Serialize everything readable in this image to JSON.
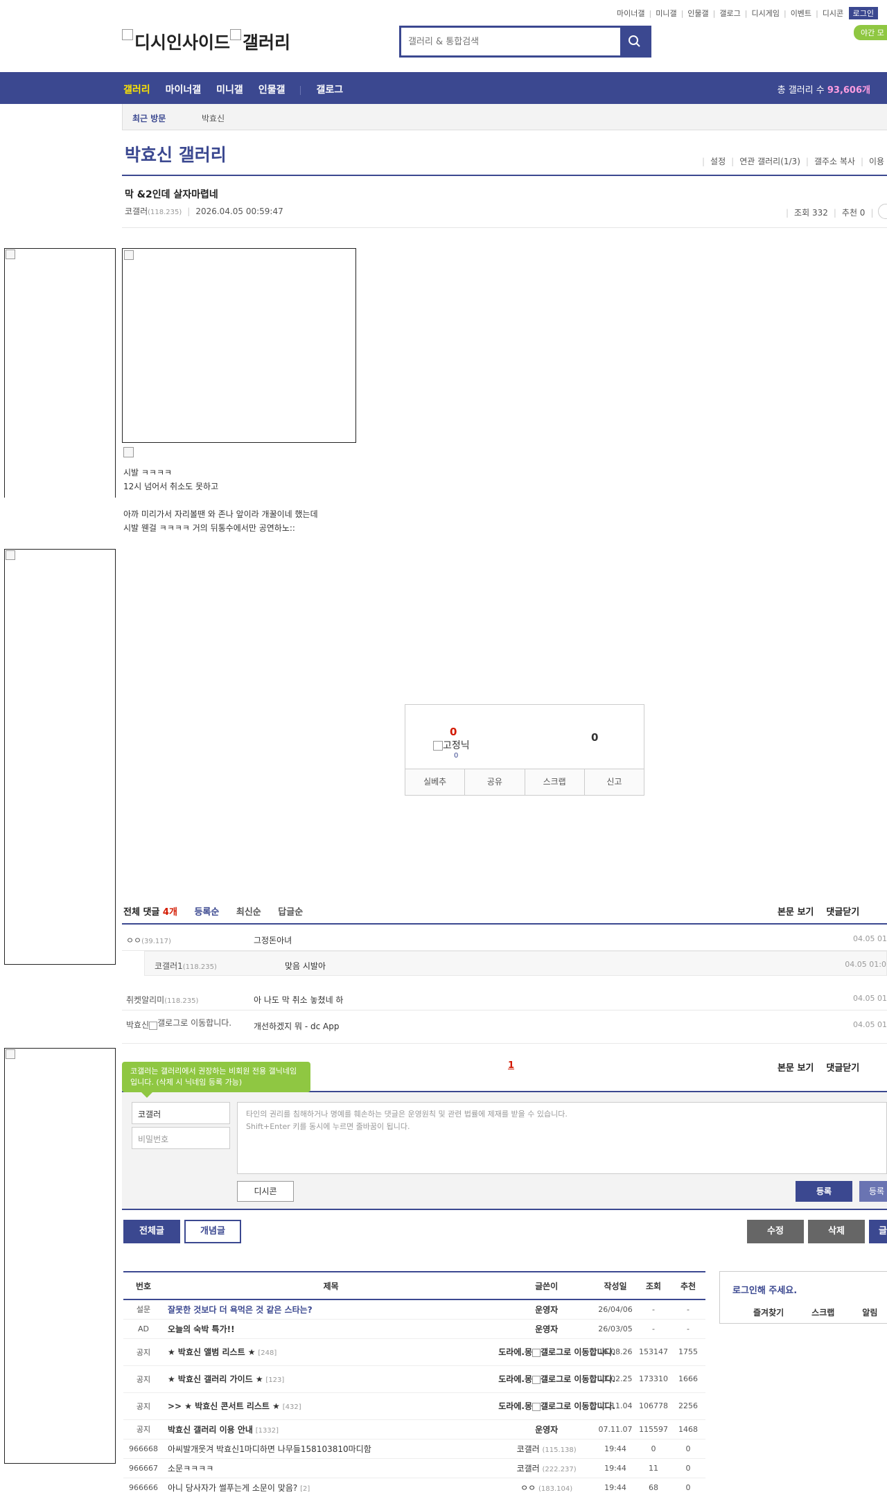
{
  "top_links": [
    "마이너갤",
    "미니갤",
    "인물갤",
    "갤로그",
    "디시게임",
    "이벤트",
    "디시콘"
  ],
  "login_label": "로그인",
  "night_mode": "야간 모",
  "logo": {
    "part1": "디시인사이드",
    "part2": "갤러리"
  },
  "search": {
    "placeholder": "갤러리 & 통합검색"
  },
  "nav": {
    "items": [
      "갤러리",
      "마이너갤",
      "미니갤",
      "인물갤",
      "갤로그"
    ],
    "count_label": "총 갤러리 수",
    "count_value": "93,606개"
  },
  "recent": {
    "label": "최근 방문",
    "item": "박효신"
  },
  "gallery": {
    "title": "박효신 갤러리",
    "links": [
      "설정",
      "연관 갤러리(1/3)",
      "갤주소 복사",
      "이용"
    ]
  },
  "post": {
    "title": "막 &2인데 살자마렵네",
    "author": "코갤러",
    "author_ip": "(118.235)",
    "datetime": "2026.04.05 00:59:47",
    "views": "조회 332",
    "recommend": "추천 0",
    "body": "시발 ㅋㅋㅋㅋ\n12시 넘어서 취소도 못하고\n\n아까 미리가서 자리볼땐 와 존나 앞이라 개꿀이네 했는데\n시발 웬걸 ㅋㅋㅋㅋ 거의 뒤통수에서만 공연하노::"
  },
  "vote": {
    "up": "0",
    "fixed_nick": "고정닉",
    "fixed_count": "0",
    "down": "0",
    "buttons": [
      "실베추",
      "공유",
      "스크랩",
      "신고"
    ]
  },
  "comments": {
    "total_label": "전체 댓글",
    "total_count": "4개",
    "sorts": [
      "등록순",
      "최신순",
      "답글순"
    ],
    "right_links": [
      "본문 보기",
      "댓글닫기"
    ],
    "items": [
      {
        "nick": "ㅇㅇ",
        "ip": "(39.117)",
        "text": "그정돈아녀",
        "date": "04.05 01"
      },
      {
        "nick": "코갤러1",
        "ip": "(118.235)",
        "text": "맞음 시발아",
        "date": "04.05 01:0"
      },
      {
        "nick": "취켓알리미",
        "ip": "(118.235)",
        "text": "아 나도 막 취소 놓쳤네 하",
        "date": "04.05 01"
      },
      {
        "nick": "박효신",
        "ip": "",
        "move": "갤로그로 이동합니다.",
        "text": "개선하겠지 뭐 - dc App",
        "date": "04.05 01"
      }
    ],
    "page": "1"
  },
  "write": {
    "tooltip": "코갤러는 갤러리에서 권장하는 비회원 전용 갤닉네임입니다. (삭제 시 닉네임 등록 가능)",
    "nick_value": "코갤러",
    "pw_placeholder": "비밀번호",
    "textarea_placeholder": "타인의 권리를 침해하거나 명예를 훼손하는 댓글은 운영원칙 및 관련 법률에 제재를 받을 수 있습니다.\nShift+Enter 키를 동시에 누르면 줄바꿈이 됩니다.",
    "dccon": "디시콘",
    "submit": "등록",
    "submit2": "등록"
  },
  "list_buttons": {
    "all": "전체글",
    "concept": "개념글",
    "edit": "수정",
    "delete": "삭제",
    "write": "글"
  },
  "table": {
    "headers": [
      "번호",
      "제목",
      "글쓴이",
      "작성일",
      "조회",
      "추천"
    ],
    "rows": [
      {
        "num": "설문",
        "subject": "잘못한 것보다 더 욕먹은 것 같은 스타는?",
        "reply": "",
        "writer": "운영자",
        "ip": "",
        "date": "26/04/06",
        "views": "-",
        "rec": "-"
      },
      {
        "num": "AD",
        "subject": "오늘의 숙박 특가!!",
        "reply": "",
        "writer": "운영자",
        "ip": "",
        "date": "26/03/05",
        "views": "-",
        "rec": "-"
      },
      {
        "num": "공지",
        "subject": "★ 박효신 앨범 리스트 ★",
        "reply": "[248]",
        "writer": "도라에.몽",
        "move": "갤로그로 이동합니다.",
        "date": "16.08.26",
        "views": "153147",
        "rec": "1755"
      },
      {
        "num": "공지",
        "subject": "★ 박효신 갤러리 가이드 ★",
        "reply": "[123]",
        "writer": "도라에.몽",
        "move": "갤로그로 이동합니다.",
        "date": "13.02.25",
        "views": "173310",
        "rec": "1666"
      },
      {
        "num": "공지",
        "subject": ">> ★ 박효신 콘서트 리스트 ★",
        "reply": "[432]",
        "writer": "도라에.몽",
        "move": "갤로그로 이동합니다.",
        "date": "11.11.04",
        "views": "106778",
        "rec": "2256"
      },
      {
        "num": "공지",
        "subject": "박효신 갤러리 이용 안내",
        "reply": "[1332]",
        "writer": "운영자",
        "ip": "",
        "date": "07.11.07",
        "views": "115597",
        "rec": "1468"
      },
      {
        "num": "966668",
        "subject": "아씨발개웃겨 박효신1마디하면 나무들158103810마디함",
        "reply": "",
        "writer": "코갤러",
        "ip": "(115.138)",
        "date": "19:44",
        "views": "0",
        "rec": "0"
      },
      {
        "num": "966667",
        "subject": "소문ㅋㅋㅋㅋ",
        "reply": "",
        "writer": "코갤러",
        "ip": "(222.237)",
        "date": "19:44",
        "views": "11",
        "rec": "0"
      },
      {
        "num": "966666",
        "subject": "아니 당사자가 썰푸는게 소문이 맞음?",
        "reply": "[2]",
        "writer": "ㅇㅇ",
        "ip": "(183.104)",
        "date": "19:44",
        "views": "68",
        "rec": "0"
      }
    ]
  },
  "login_panel": {
    "title": "로그인해 주세요.",
    "links": [
      "즐겨찾기",
      "스크랩",
      "알림"
    ]
  }
}
